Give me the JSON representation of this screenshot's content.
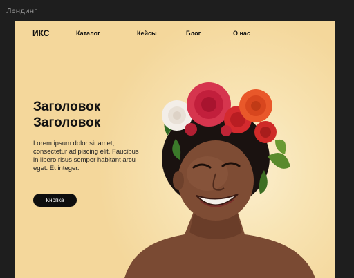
{
  "app": {
    "frame_label": "Лендинг"
  },
  "header": {
    "logo": "ИКС",
    "nav": [
      {
        "label": "Каталог"
      },
      {
        "label": "Кейсы"
      },
      {
        "label": "Блог"
      },
      {
        "label": "О нас"
      }
    ]
  },
  "hero": {
    "heading_line1": "Заголовок",
    "heading_line2": "Заголовок",
    "body": "Lorem ipsum dolor sit amet, consectetur adipiscing elit. Faucibus in libero risus semper habitant arcu eget. Et integer.",
    "button_label": "Кнопка"
  },
  "colors": {
    "background": "#f4d79b",
    "button": "#0e0e0e",
    "editor_bg": "#1e1e1e"
  }
}
